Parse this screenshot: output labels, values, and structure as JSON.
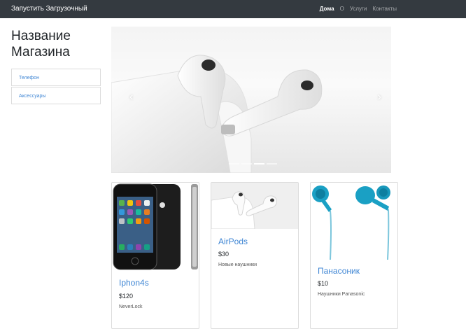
{
  "navbar": {
    "brand": "Запустить Загрузочный",
    "links": [
      {
        "label": "Дома",
        "active": true
      },
      {
        "label": "О",
        "active": false
      },
      {
        "label": "Услуги",
        "active": false
      },
      {
        "label": "Контакты",
        "active": false
      }
    ]
  },
  "sidebar": {
    "title": "Название Магазина",
    "items": [
      {
        "label": "Телефон"
      },
      {
        "label": "Аксессуары"
      }
    ]
  },
  "carousel": {
    "prev_icon": "chevron-left-icon",
    "next_icon": "chevron-right-icon",
    "indicator_count": 4,
    "active_indicator": 3
  },
  "products": [
    {
      "name": "Iphon4s",
      "price": "$120",
      "description": "NeverLock"
    },
    {
      "name": "AirPods",
      "price": "$30",
      "description": "Новые наушники"
    },
    {
      "name": "Панасоник",
      "price": "$10",
      "description": "Наушники Panasonic"
    }
  ],
  "colors": {
    "navbar_bg": "#343a40",
    "link": "#3f86d4",
    "earphone_blue": "#1aa0c4"
  }
}
